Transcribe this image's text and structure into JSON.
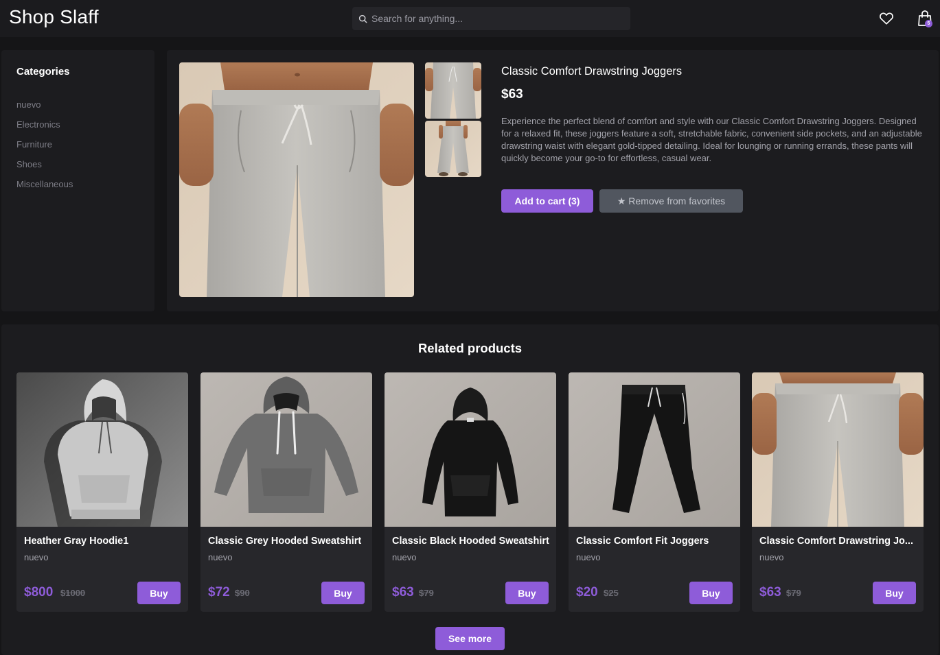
{
  "header": {
    "logo": "Shop Slaff",
    "search_placeholder": "Search for anything...",
    "cart_count": "5",
    "icons": [
      "search-icon",
      "heart-icon",
      "shopping-bag-icon"
    ]
  },
  "sidebar": {
    "title": "Categories",
    "items": [
      {
        "label": "nuevo"
      },
      {
        "label": "Electronics"
      },
      {
        "label": "Furniture"
      },
      {
        "label": "Shoes"
      },
      {
        "label": "Miscellaneous"
      }
    ]
  },
  "product": {
    "title": "Classic Comfort Drawstring Joggers",
    "price": "$63",
    "description": "Experience the perfect blend of comfort and style with our Classic Comfort Drawstring Joggers. Designed for a relaxed fit, these joggers feature a soft, stretchable fabric, convenient side pockets, and an adjustable drawstring waist with elegant gold-tipped detailing. Ideal for lounging or running errands, these pants will quickly become your go-to for effortless, casual wear.",
    "add_to_cart_label": "Add to cart (3)",
    "favorite_label": "★ Remove from favorites"
  },
  "related": {
    "title": "Related products",
    "see_more_label": "See more",
    "buy_label": "Buy",
    "items": [
      {
        "name": "Heather Gray Hoodie1",
        "category": "nuevo",
        "price": "$800",
        "old_price": "$1000"
      },
      {
        "name": "Classic Grey Hooded Sweatshirt",
        "category": "nuevo",
        "price": "$72",
        "old_price": "$90"
      },
      {
        "name": "Classic Black Hooded Sweatshirt",
        "category": "nuevo",
        "price": "$63",
        "old_price": "$79"
      },
      {
        "name": "Classic Comfort Fit Joggers",
        "category": "nuevo",
        "price": "$20",
        "old_price": "$25"
      },
      {
        "name": "Classic Comfort Drawstring Jo...",
        "category": "nuevo",
        "price": "$63",
        "old_price": "$79"
      }
    ]
  },
  "colors": {
    "accent": "#8e5cd9",
    "background": "#151517",
    "panel": "#1c1c1f",
    "card": "#27272b"
  }
}
